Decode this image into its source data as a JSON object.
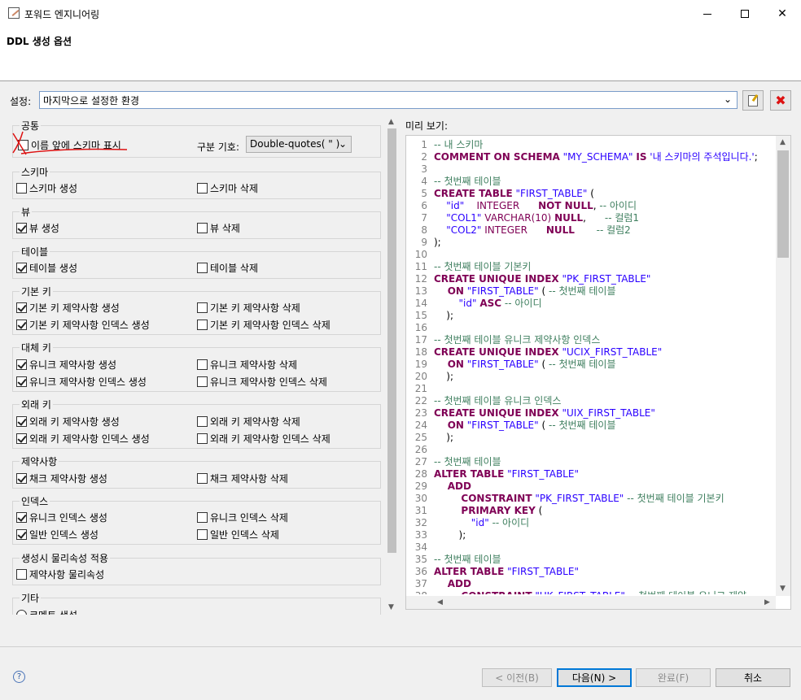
{
  "window": {
    "title": "포워드 엔지니어링",
    "minimize": "—",
    "maximize": "☐",
    "close": "✕"
  },
  "header": {
    "title": "DDL 생성 옵션"
  },
  "settings": {
    "label": "설정:",
    "value": "마지막으로 설정한 환경",
    "edit_icon": "edit-icon",
    "delete_icon": "delete-icon"
  },
  "groups": {
    "common": {
      "title": "공통",
      "schema_prefix": {
        "label": "이름 앞에 스키마 표시",
        "checked": false
      },
      "delimiter_label": "구분 기호:",
      "delimiter_value": "Double-quotes( \" )"
    },
    "schema": {
      "title": "스키마",
      "create": {
        "label": "스키마 생성",
        "checked": false
      },
      "drop": {
        "label": "스키마 삭제",
        "checked": false
      }
    },
    "view": {
      "title": "뷰",
      "create": {
        "label": "뷰 생성",
        "checked": true
      },
      "drop": {
        "label": "뷰 삭제",
        "checked": false
      }
    },
    "table": {
      "title": "테이블",
      "create": {
        "label": "테이블 생성",
        "checked": true
      },
      "drop": {
        "label": "테이블 삭제",
        "checked": false
      }
    },
    "pk": {
      "title": "기본 키",
      "create": {
        "label": "기본 키 제약사항 생성",
        "checked": true
      },
      "drop": {
        "label": "기본 키 제약사항 삭제",
        "checked": false
      },
      "idx_create": {
        "label": "기본 키 제약사항 인덱스 생성",
        "checked": true
      },
      "idx_drop": {
        "label": "기본 키 제약사항 인덱스 삭제",
        "checked": false
      }
    },
    "ak": {
      "title": "대체 키",
      "create": {
        "label": "유니크 제약사항 생성",
        "checked": true
      },
      "drop": {
        "label": "유니크 제약사항 삭제",
        "checked": false
      },
      "idx_create": {
        "label": "유니크 제약사항 인덱스 생성",
        "checked": true
      },
      "idx_drop": {
        "label": "유니크 제약사항 인덱스 삭제",
        "checked": false
      }
    },
    "fk": {
      "title": "외래 키",
      "create": {
        "label": "외래 키 제약사항 생성",
        "checked": true
      },
      "drop": {
        "label": "외래 키 제약사항 삭제",
        "checked": false
      },
      "idx_create": {
        "label": "외래 키 제약사항 인덱스 생성",
        "checked": true
      },
      "idx_drop": {
        "label": "외래 키 제약사항 인덱스 삭제",
        "checked": false
      }
    },
    "constraint": {
      "title": "제약사항",
      "create": {
        "label": "채크 제약사항 생성",
        "checked": true
      },
      "drop": {
        "label": "채크 제약사항 삭제",
        "checked": false
      }
    },
    "index": {
      "title": "인덱스",
      "uq_create": {
        "label": "유니크 인덱스 생성",
        "checked": true
      },
      "uq_drop": {
        "label": "유니크 인덱스 삭제",
        "checked": false
      },
      "gen_create": {
        "label": "일반 인덱스 생성",
        "checked": true
      },
      "gen_drop": {
        "label": "일반 인덱스 삭제",
        "checked": false
      }
    },
    "physical": {
      "title": "생성시 물리속성 적용",
      "constraint": {
        "label": "제약사항 물리속성",
        "checked": false
      }
    },
    "etc": {
      "title": "기타",
      "comment": {
        "label": "코멘트 생성"
      }
    }
  },
  "preview": {
    "label": "미리 보기:",
    "lines": [
      [
        [
          "cm",
          "-- 내 스키마"
        ]
      ],
      [
        [
          "kw",
          "COMMENT ON SCHEMA"
        ],
        [
          "str",
          " \"MY_SCHEMA\" "
        ],
        [
          "kw",
          "IS"
        ],
        [
          "str",
          " '내 스키마의 주석입니다.'"
        ],
        [
          "",
          ";"
        ]
      ],
      [
        [
          "",
          ""
        ]
      ],
      [
        [
          "cm",
          "-- 첫번째 테이블"
        ]
      ],
      [
        [
          "kw",
          "CREATE TABLE"
        ],
        [
          "str",
          " \"FIRST_TABLE\" "
        ],
        [
          "",
          "("
        ]
      ],
      [
        [
          "str",
          "    \"id\"    "
        ],
        [
          "typ",
          "INTEGER      "
        ],
        [
          "kw",
          "NOT NULL"
        ],
        [
          "",
          ", "
        ],
        [
          "cm",
          "-- 아이디"
        ]
      ],
      [
        [
          "str",
          "    \"COL1\" "
        ],
        [
          "typ",
          "VARCHAR(10) "
        ],
        [
          "kw",
          "NULL"
        ],
        [
          "",
          ",      "
        ],
        [
          "cm",
          "-- 컬럼1"
        ]
      ],
      [
        [
          "str",
          "    \"COL2\" "
        ],
        [
          "typ",
          "INTEGER      "
        ],
        [
          "kw",
          "NULL"
        ],
        [
          "",
          "       "
        ],
        [
          "cm",
          "-- 컬럼2"
        ]
      ],
      [
        [
          "",
          ");"
        ]
      ],
      [
        [
          "",
          ""
        ]
      ],
      [
        [
          "cm",
          "-- 첫번째 테이블 기본키"
        ]
      ],
      [
        [
          "kw",
          "CREATE UNIQUE INDEX"
        ],
        [
          "str",
          " \"PK_FIRST_TABLE\""
        ]
      ],
      [
        [
          "kw",
          "    ON"
        ],
        [
          "str",
          " \"FIRST_TABLE\" "
        ],
        [
          "",
          "( "
        ],
        [
          "cm",
          "-- 첫번째 테이블"
        ]
      ],
      [
        [
          "str",
          "        \"id\" "
        ],
        [
          "kw",
          "ASC"
        ],
        [
          "cm",
          " -- 아이디"
        ]
      ],
      [
        [
          "",
          "    );"
        ]
      ],
      [
        [
          "",
          ""
        ]
      ],
      [
        [
          "cm",
          "-- 첫번째 테이블 유니크 제약사항 인덱스"
        ]
      ],
      [
        [
          "kw",
          "CREATE UNIQUE INDEX"
        ],
        [
          "str",
          " \"UCIX_FIRST_TABLE\""
        ]
      ],
      [
        [
          "kw",
          "    ON"
        ],
        [
          "str",
          " \"FIRST_TABLE\" "
        ],
        [
          "",
          "( "
        ],
        [
          "cm",
          "-- 첫번째 테이블"
        ]
      ],
      [
        [
          "",
          "    );"
        ]
      ],
      [
        [
          "",
          ""
        ]
      ],
      [
        [
          "cm",
          "-- 첫번째 테이블 유니크 인덱스"
        ]
      ],
      [
        [
          "kw",
          "CREATE UNIQUE INDEX"
        ],
        [
          "str",
          " \"UIX_FIRST_TABLE\""
        ]
      ],
      [
        [
          "kw",
          "    ON"
        ],
        [
          "str",
          " \"FIRST_TABLE\" "
        ],
        [
          "",
          "( "
        ],
        [
          "cm",
          "-- 첫번째 테이블"
        ]
      ],
      [
        [
          "",
          "    );"
        ]
      ],
      [
        [
          "",
          ""
        ]
      ],
      [
        [
          "cm",
          "-- 첫번째 테이블"
        ]
      ],
      [
        [
          "kw",
          "ALTER TABLE"
        ],
        [
          "str",
          " \"FIRST_TABLE\""
        ]
      ],
      [
        [
          "kw",
          "    ADD"
        ]
      ],
      [
        [
          "kw",
          "        CONSTRAINT"
        ],
        [
          "str",
          " \"PK_FIRST_TABLE\" "
        ],
        [
          "cm",
          "-- 첫번째 테이블 기본키"
        ]
      ],
      [
        [
          "kw",
          "        PRIMARY KEY"
        ],
        [
          "",
          " ("
        ]
      ],
      [
        [
          "str",
          "            \"id\" "
        ],
        [
          "cm",
          "-- 아이디"
        ]
      ],
      [
        [
          "",
          "        );"
        ]
      ],
      [
        [
          "",
          ""
        ]
      ],
      [
        [
          "cm",
          "-- 첫번째 테이블"
        ]
      ],
      [
        [
          "kw",
          "ALTER TABLE"
        ],
        [
          "str",
          " \"FIRST_TABLE\""
        ]
      ],
      [
        [
          "kw",
          "    ADD"
        ]
      ],
      [
        [
          "kw",
          "        CONSTRAINT"
        ],
        [
          "str",
          " \"UK_FIRST_TABLE\" "
        ],
        [
          "cm",
          "-- 첫번째 테이블 유니크 제약"
        ]
      ]
    ]
  },
  "footer": {
    "help_icon": "help-icon",
    "help_glyph": "?",
    "prev": "< 이전(B)",
    "next": "다음(N) >",
    "finish": "완료(F)",
    "cancel": "취소"
  }
}
